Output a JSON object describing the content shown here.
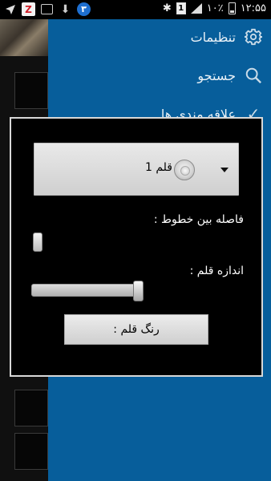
{
  "status_bar": {
    "time": "۱۲:۵۵",
    "battery_percent": "۱۰٪",
    "sim_label": "1",
    "notification_badge": "۳",
    "zapp_letter": "Z"
  },
  "drawer": {
    "items": [
      {
        "label": "تنظیمات",
        "icon": "gear-icon"
      },
      {
        "label": "جستجو",
        "icon": "search-icon"
      },
      {
        "label": "علاقه مندی ها",
        "icon": "check-icon"
      }
    ],
    "background_color": "#075e9b"
  },
  "dialog": {
    "font_selector": {
      "selected_label": "قلم 1"
    },
    "line_spacing_label": "فاصله بین خطوط :",
    "line_spacing_value": 0.0,
    "font_size_label": "اندازه قلم :",
    "font_size_value": 1.0,
    "pen_color_button": "رنگ قلم :"
  }
}
